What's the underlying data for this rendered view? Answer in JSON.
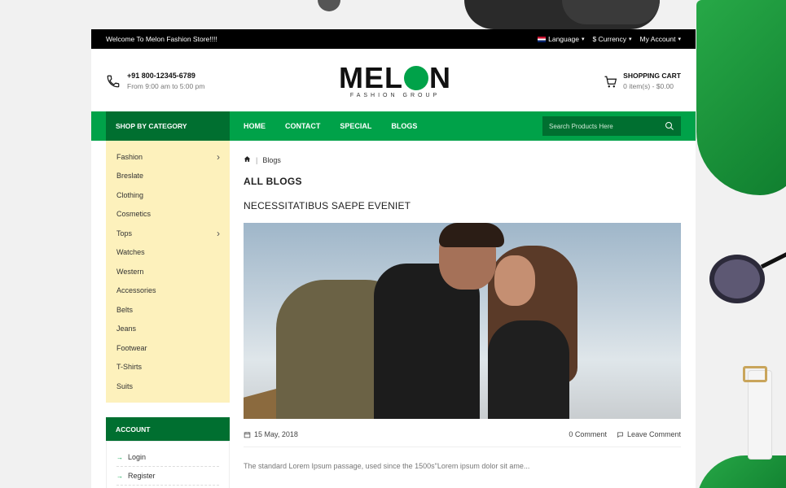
{
  "topbar": {
    "welcome": "Welcome To Melon Fashion Store!!!!",
    "language": "Language",
    "currency": "$ Currency",
    "account": "My Account"
  },
  "header": {
    "phone": "+91 800-12345-6789",
    "hours": "From 9:00 am to 5:00 pm",
    "logo_main": "MEL",
    "logo_end": "N",
    "logo_sub": "FASHION GROUP",
    "cart_title": "SHOPPING CART",
    "cart_summary": "0 item(s) - $0.00"
  },
  "nav": {
    "category_button": "SHOP BY CATEGORY",
    "items": [
      "HOME",
      "CONTACT",
      "SPECIAL",
      "BLOGS"
    ],
    "search_placeholder": "Search Products Here"
  },
  "sidebar": {
    "categories": [
      {
        "label": "Fashion",
        "sub": true
      },
      {
        "label": "Breslate",
        "sub": false
      },
      {
        "label": "Clothing",
        "sub": false
      },
      {
        "label": "Cosmetics",
        "sub": false
      },
      {
        "label": "Tops",
        "sub": true
      },
      {
        "label": "Watches",
        "sub": false
      },
      {
        "label": "Western",
        "sub": false
      },
      {
        "label": "Accessories",
        "sub": false
      },
      {
        "label": "Belts",
        "sub": false
      },
      {
        "label": "Jeans",
        "sub": false
      },
      {
        "label": "Footwear",
        "sub": false
      },
      {
        "label": "T-Shirts",
        "sub": false
      },
      {
        "label": "Suits",
        "sub": false
      }
    ],
    "account_title": "ACCOUNT",
    "account_items": [
      "Login",
      "Register"
    ]
  },
  "main": {
    "breadcrumb": "Blogs",
    "heading": "ALL BLOGS",
    "post_title": "NECESSITATIBUS SAEPE EVENIET",
    "date": "15 May, 2018",
    "comments": "0 Comment",
    "leave_comment": "Leave Comment",
    "excerpt": "The standard Lorem Ipsum passage, used since the 1500s\"Lorem ipsum dolor sit ame..."
  },
  "colors": {
    "brand_green": "#00a249",
    "dark_green": "#006f30",
    "sidebar_bg": "#fdf1bc"
  }
}
